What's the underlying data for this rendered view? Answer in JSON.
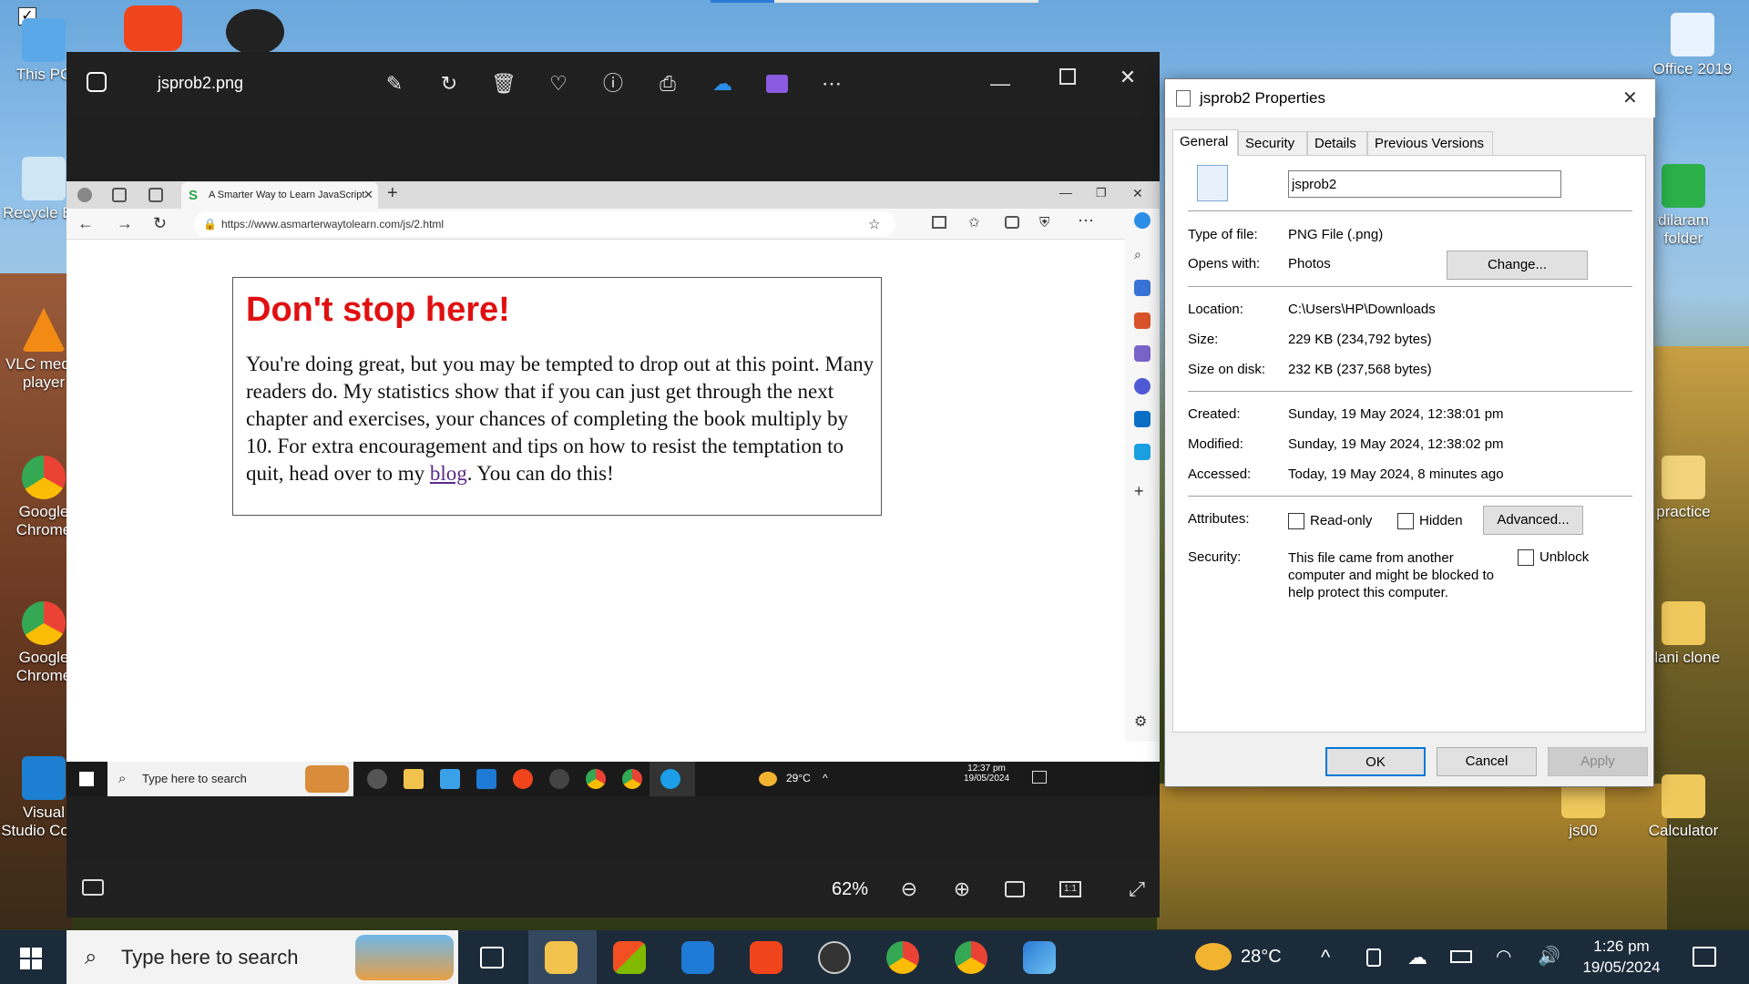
{
  "desktop": {
    "icons": [
      {
        "label": "This PC"
      },
      {
        "label": "Recycle Bin"
      },
      {
        "label": "VLC media player"
      },
      {
        "label": "Google Chrome"
      },
      {
        "label": "Google Chrome"
      },
      {
        "label": "Visual Studio Code"
      },
      {
        "label": "Office 2019"
      },
      {
        "label": "dilaram folder"
      },
      {
        "label": "practice"
      },
      {
        "label": "ylani clone"
      },
      {
        "label": "js00"
      },
      {
        "label": "Calculator"
      }
    ]
  },
  "photos_viewer": {
    "filename": "jsprob2.png",
    "zoom": "62%",
    "toolbar_icons": [
      "edit-icon",
      "rotate-icon",
      "delete-icon",
      "favorite-icon",
      "info-icon",
      "print-icon",
      "onedrive-icon",
      "clipchamp-icon",
      "more-icon"
    ]
  },
  "inner_browser": {
    "tab_title": "A Smarter Way to Learn JavaScript",
    "url": "https://www.asmarterwaytolearn.com/js/2.html",
    "heading": "Don't stop here!",
    "body_before_link": "You're doing great, but you may be tempted to drop out at this point. Many readers do. My statistics show that if you can just get through the next chapter and exercises, your chances of completing the book multiply by 10. For extra encouragement and tips on how to resist the temptation to quit, head over to my ",
    "link_text": "blog",
    "body_after_link": ". You can do this!",
    "taskbar": {
      "search_placeholder": "Type here to search",
      "temperature": "29°C",
      "time": "12:37 pm",
      "date": "19/05/2024"
    }
  },
  "properties": {
    "title": "jsprob2 Properties",
    "tabs": [
      "General",
      "Security",
      "Details",
      "Previous Versions"
    ],
    "name_value": "jsprob2",
    "type_label": "Type of file:",
    "type_value": "PNG File (.png)",
    "opens_label": "Opens with:",
    "opens_value": "Photos",
    "change_button": "Change...",
    "location_label": "Location:",
    "location_value": "C:\\Users\\HP\\Downloads",
    "size_label": "Size:",
    "size_value": "229 KB (234,792 bytes)",
    "size_disk_label": "Size on disk:",
    "size_disk_value": "232 KB (237,568 bytes)",
    "created_label": "Created:",
    "created_value": "Sunday, 19 May 2024, 12:38:01 pm",
    "modified_label": "Modified:",
    "modified_value": "Sunday, 19 May 2024, 12:38:02 pm",
    "accessed_label": "Accessed:",
    "accessed_value": "Today, 19 May 2024, 8 minutes ago",
    "attributes_label": "Attributes:",
    "readonly_label": "Read-only",
    "hidden_label": "Hidden",
    "advanced_button": "Advanced...",
    "security_label": "Security:",
    "security_text": "This file came from another computer and might be blocked to help protect this computer.",
    "unblock_label": "Unblock",
    "ok_button": "OK",
    "cancel_button": "Cancel",
    "apply_button": "Apply"
  },
  "taskbar": {
    "search_placeholder": "Type here to search",
    "temperature": "28°C",
    "time": "1:26 pm",
    "date": "19/05/2024"
  }
}
